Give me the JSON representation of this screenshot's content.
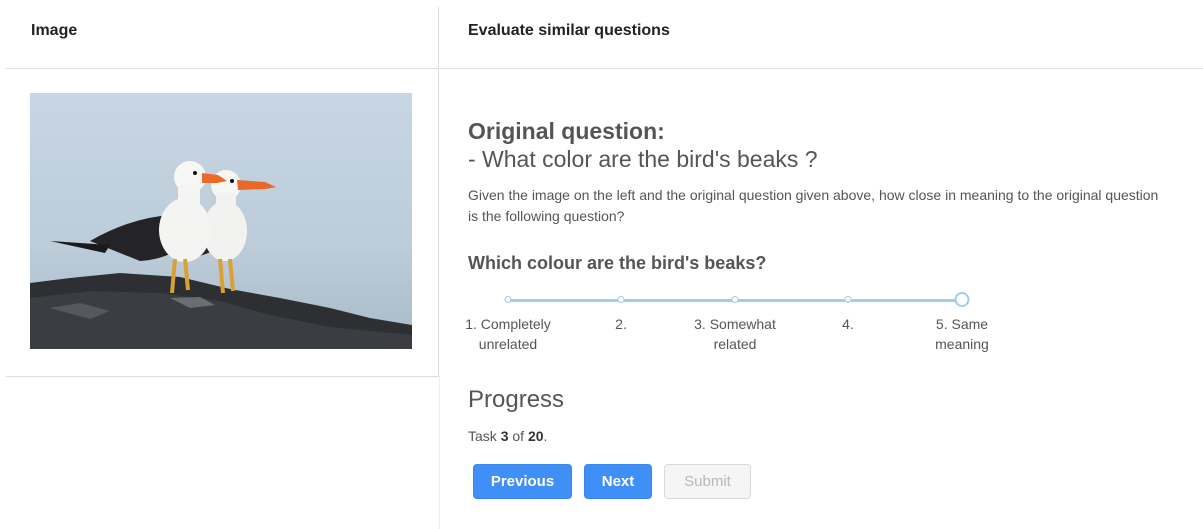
{
  "left_panel": {
    "title": "Image"
  },
  "right_panel": {
    "title": "Evaluate similar questions"
  },
  "original": {
    "heading": "Original question:",
    "question": "- What color are the bird's beaks ?"
  },
  "instructions": "Given the image on the left and the original question given above, how close in meaning to the original question is the following question?",
  "candidate_question": "Which colour are the bird's beaks?",
  "scale": {
    "selected_index": 4,
    "options": [
      {
        "label": "1. Completely unrelated"
      },
      {
        "label": "2."
      },
      {
        "label": "3. Somewhat related"
      },
      {
        "label": "4."
      },
      {
        "label": "5. Same meaning"
      }
    ]
  },
  "progress": {
    "title": "Progress",
    "prefix": "Task ",
    "current": "3",
    "middle": " of ",
    "total": "20",
    "suffix": "."
  },
  "buttons": {
    "previous": "Previous",
    "next": "Next",
    "submit": "Submit"
  },
  "colors": {
    "primary": "#3f8ff7",
    "scale_accent": "#9dcdf2",
    "disabled_bg": "#f5f5f5"
  }
}
